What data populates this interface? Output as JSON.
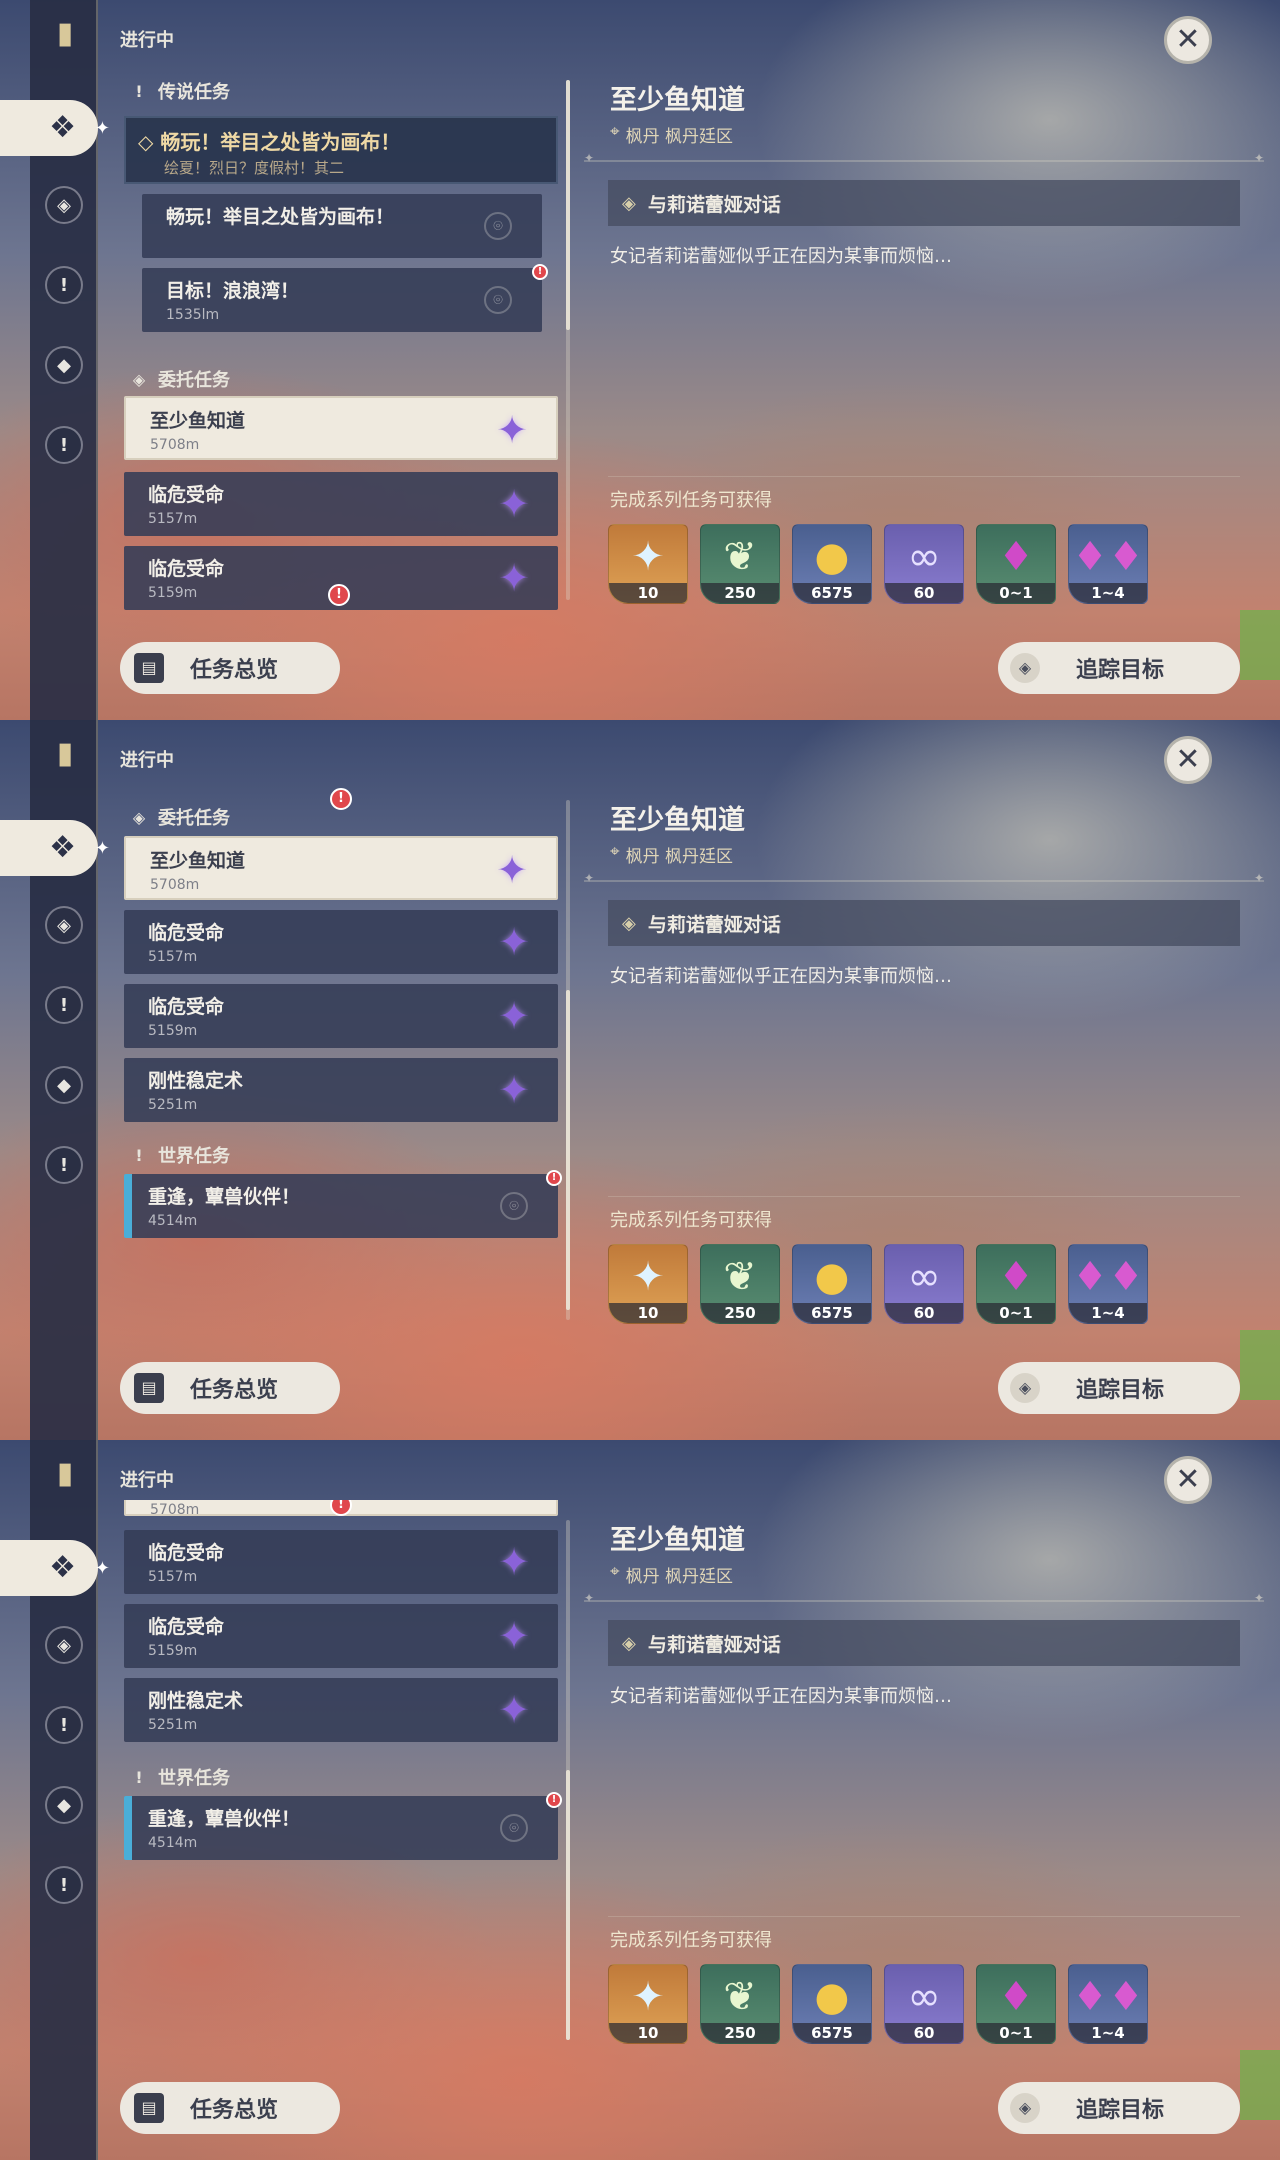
{
  "header": {
    "title": "进行中"
  },
  "sections": {
    "legend": "传说任务",
    "commission": "委托任务",
    "world": "世界任务"
  },
  "legend_quest": {
    "title": "畅玩！举目之处皆为画布！",
    "subtitle": "绘夏！烈日？度假村！其二",
    "steps": [
      {
        "name": "畅玩！举目之处皆为画布！",
        "distance": ""
      },
      {
        "name": "目标！浪浪湾！",
        "distance": "1535lm"
      }
    ]
  },
  "commissions": [
    {
      "name": "至少鱼知道",
      "distance": "5708m"
    },
    {
      "name": "临危受命",
      "distance": "5157m"
    },
    {
      "name": "临危受命",
      "distance": "5159m"
    },
    {
      "name": "刚性稳定术",
      "distance": "5251m"
    }
  ],
  "world_quests": [
    {
      "name": "重逢，蕈兽伙伴！",
      "distance": "4514m"
    }
  ],
  "detail": {
    "title": "至少鱼知道",
    "location": "枫丹  枫丹廷区",
    "objective": "与莉诺蕾娅对话",
    "description": "女记者莉诺蕾娅似乎正在因为某事而烦恼…",
    "reward_label": "完成系列任务可获得",
    "rewards": [
      {
        "icon": "primogem-icon",
        "count": "10"
      },
      {
        "icon": "adventure-exp-icon",
        "count": "250"
      },
      {
        "icon": "mora-icon",
        "count": "6575"
      },
      {
        "icon": "companionship-exp-icon",
        "count": "60"
      },
      {
        "icon": "crystal-icon",
        "count": "0~1"
      },
      {
        "icon": "crystal-cluster-icon",
        "count": "1~4"
      }
    ]
  },
  "buttons": {
    "overview": "任务总览",
    "track": "追踪目标"
  },
  "icons": {
    "alert": "!",
    "close": "✕"
  },
  "colors": {
    "accent": "#efeadf",
    "star": "#8a62d8",
    "alert": "#e0474c",
    "world_marker": "#4aaed8"
  }
}
